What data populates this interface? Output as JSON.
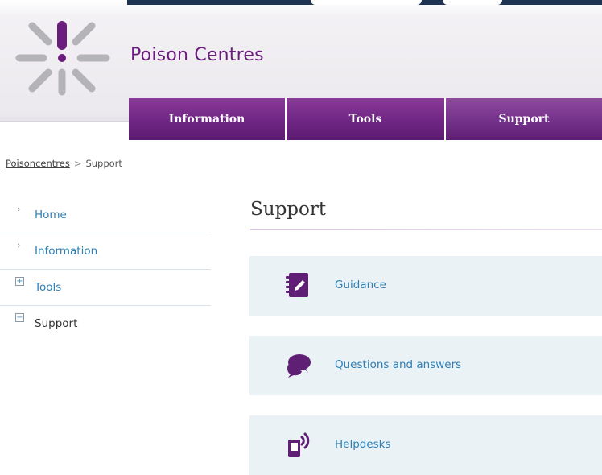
{
  "site": {
    "title": "Poison Centres"
  },
  "colors": {
    "brand_purple": "#6a1d7d",
    "link_blue": "#2d7fb6",
    "card_bg": "#eaf2f6",
    "dark_strip": "#1f3352"
  },
  "nav": {
    "tabs": [
      {
        "label": "Information",
        "active": false
      },
      {
        "label": "Tools",
        "active": false
      },
      {
        "label": "Support",
        "active": true
      }
    ]
  },
  "breadcrumb": {
    "root": "Poisoncentres",
    "separator": ">",
    "current": "Support"
  },
  "sidebar": {
    "items": [
      {
        "label": "Home",
        "marker": "chevron-right-icon"
      },
      {
        "label": "Information",
        "marker": "chevron-right-icon"
      },
      {
        "label": "Tools",
        "marker": "plus-box-icon"
      },
      {
        "label": "Support",
        "marker": "minus-box-icon"
      }
    ]
  },
  "main": {
    "heading": "Support",
    "cards": [
      {
        "label": "Guidance",
        "icon": "notebook-pencil-icon"
      },
      {
        "label": "Questions and answers",
        "icon": "speech-bubbles-icon"
      },
      {
        "label": "Helpdesks",
        "icon": "phone-signal-icon"
      }
    ]
  }
}
